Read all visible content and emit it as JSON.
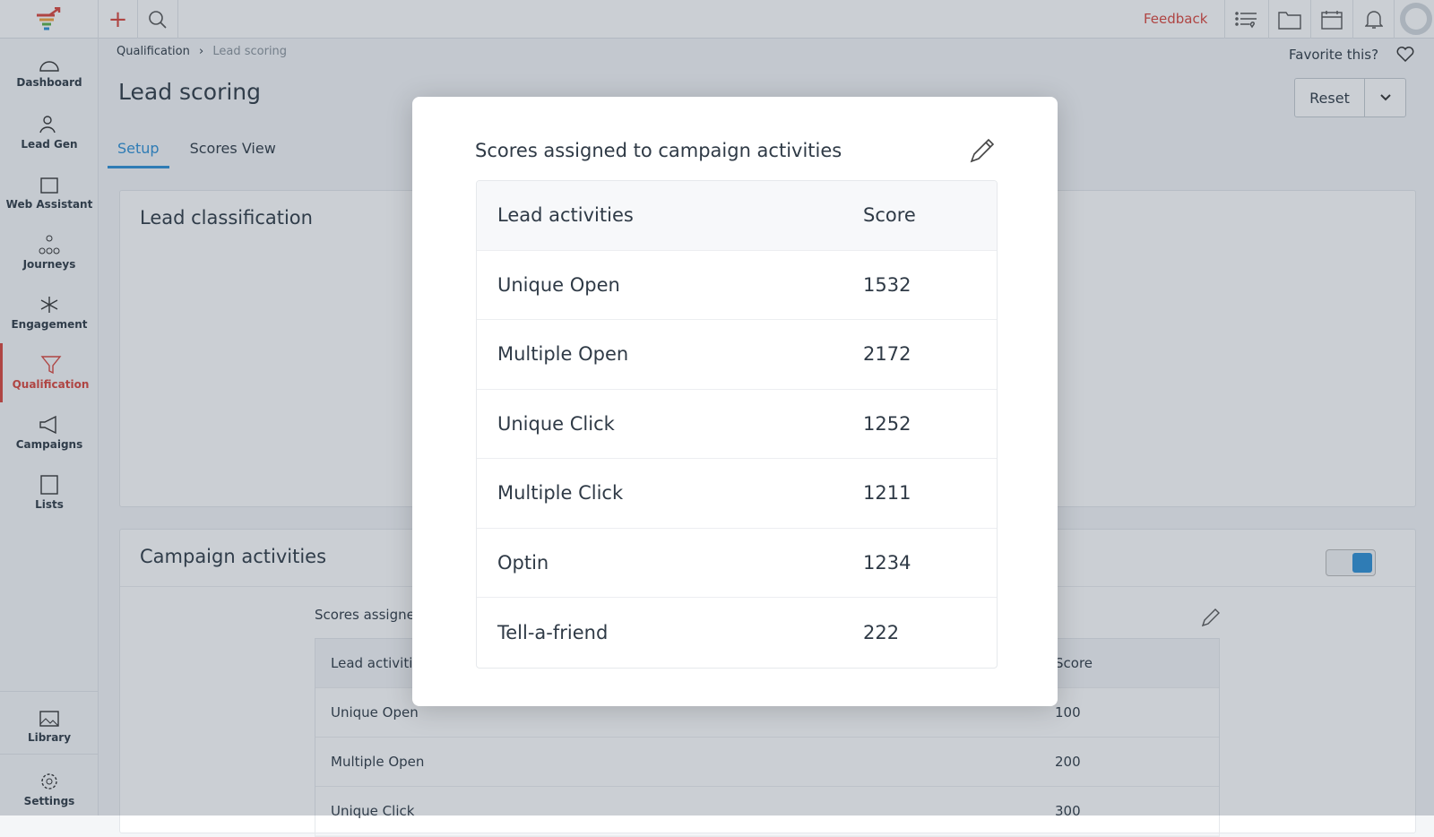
{
  "topbar": {
    "feedback": "Feedback",
    "icons": [
      "add-icon",
      "search-icon",
      "list-heart-icon",
      "folder-icon",
      "calendar-icon",
      "bell-icon",
      "avatar"
    ]
  },
  "sidebar": {
    "items": [
      {
        "label": "Dashboard",
        "icon": "dashboard-icon"
      },
      {
        "label": "Lead Gen",
        "icon": "lead-gen-icon"
      },
      {
        "label": "Web Assistant",
        "icon": "web-assistant-icon"
      },
      {
        "label": "Journeys",
        "icon": "journeys-icon"
      },
      {
        "label": "Engagement",
        "icon": "engagement-icon"
      },
      {
        "label": "Qualification",
        "icon": "funnel-icon",
        "active": true
      },
      {
        "label": "Campaigns",
        "icon": "megaphone-icon"
      },
      {
        "label": "Lists",
        "icon": "lists-icon"
      }
    ],
    "bottom": [
      {
        "label": "Library",
        "icon": "image-icon"
      },
      {
        "label": "Settings",
        "icon": "gear-icon"
      }
    ]
  },
  "breadcrumb": {
    "parent": "Qualification",
    "separator": "›",
    "current": "Lead scoring"
  },
  "page": {
    "title": "Lead scoring",
    "favorite": "Favorite this?",
    "reset": "Reset"
  },
  "tabs": [
    {
      "label": "Setup",
      "active": true
    },
    {
      "label": "Scores View"
    }
  ],
  "panels": {
    "classification": "Lead classification",
    "campaign": "Campaign activities",
    "toggle_on": true,
    "inner_title": "Scores assigne",
    "table": {
      "headers": [
        "Lead activiti",
        "Score"
      ],
      "rows": [
        [
          "Unique Open",
          "100"
        ],
        [
          "Multiple Open",
          "200"
        ],
        [
          "Unique Click",
          "300"
        ]
      ]
    }
  },
  "modal": {
    "title": "Scores assigned to campaign activities",
    "headers": [
      "Lead activities",
      "Score"
    ],
    "rows": [
      [
        "Unique Open",
        "1532"
      ],
      [
        "Multiple Open",
        "2172"
      ],
      [
        "Unique Click",
        "1252"
      ],
      [
        "Multiple Click",
        "1211"
      ],
      [
        "Optin",
        "1234"
      ],
      [
        "Tell-a-friend",
        "222"
      ]
    ]
  },
  "colors": {
    "accent": "#2d8fd5",
    "active": "#d9453c"
  }
}
